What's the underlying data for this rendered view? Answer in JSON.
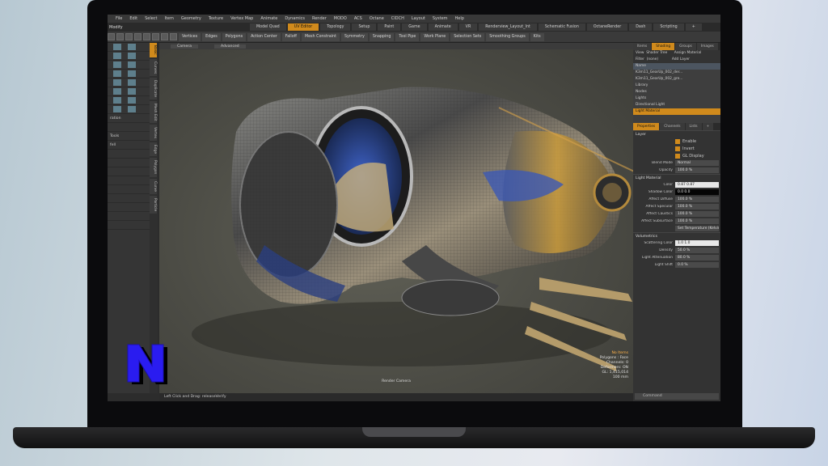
{
  "menubar": [
    "File",
    "Edit",
    "Select",
    "Item",
    "Geometry",
    "Texture",
    "Vertex Map",
    "Animate",
    "Dynamics",
    "Render",
    "MODO",
    "ACS",
    "Octane",
    "CIDCH",
    "Layout",
    "System",
    "Help"
  ],
  "workspace": "Modify",
  "layout_tabs": [
    {
      "label": "Model Quad",
      "active": false
    },
    {
      "label": "UV Editor",
      "active": true
    },
    {
      "label": "Topology",
      "active": false
    },
    {
      "label": "Setup",
      "active": false
    },
    {
      "label": "Paint",
      "active": false
    },
    {
      "label": "Game",
      "active": false
    },
    {
      "label": "Animate",
      "active": false
    },
    {
      "label": "VR",
      "active": false
    },
    {
      "label": "Renderview_Layout_Int",
      "active": false
    },
    {
      "label": "Schematic Fusion",
      "active": false
    },
    {
      "label": "OctaneRender",
      "active": false
    },
    {
      "label": "Dash",
      "active": false
    },
    {
      "label": "Scripting",
      "active": false
    },
    {
      "label": "+",
      "active": false
    }
  ],
  "toolbar": [
    "Vertices",
    "Edges",
    "Polygons",
    "Action Center",
    "Falloff",
    "Mesh Constraint",
    "Symmetry",
    "Snapping",
    "Tool Pipe",
    "Work Plane",
    "Selection Sets",
    "Smoothing Groups",
    "Kits"
  ],
  "left_panel_rows": [
    "",
    "",
    "",
    "",
    "",
    "",
    "",
    "",
    "ration",
    "",
    "Tools",
    "fell",
    "",
    "",
    "",
    "",
    "",
    "",
    "",
    "",
    ""
  ],
  "vertical_tabs": [
    {
      "label": "Basic",
      "active": true
    },
    {
      "label": "Curves",
      "active": false
    },
    {
      "label": "Duplicate",
      "active": false
    },
    {
      "label": "Mesh Edit",
      "active": false
    },
    {
      "label": "Vertex",
      "active": false
    },
    {
      "label": "Edge",
      "active": false
    },
    {
      "label": "Polygon",
      "active": false
    },
    {
      "label": "Curve",
      "active": false
    },
    {
      "label": "Particle",
      "active": false
    }
  ],
  "viewport": {
    "header_tabs": [
      "Camera",
      "Advanced"
    ],
    "stats": [
      "No Items",
      "Polygons : Face",
      "Channels: 0",
      "Deformers: ON",
      "GL: 1,415,014",
      "100 mm"
    ],
    "camera_label": "Render Camera"
  },
  "statusbar": "Left Click and Drag:  releaseVerify",
  "right_panel": {
    "tabs": [
      {
        "label": "Items",
        "active": false
      },
      {
        "label": "Shading",
        "active": true
      },
      {
        "label": "Groups",
        "active": false
      },
      {
        "label": "Images",
        "active": false
      }
    ],
    "view_label": "View",
    "view_value": "Shader Tree",
    "filter_label": "Filter",
    "filter_value": "(none)",
    "assign_button": "Assign Material",
    "add_layer_button": "Add Layer",
    "tree_header": "Name",
    "tree": [
      {
        "label": "K3m11_GearUp_002_der...",
        "sel": false
      },
      {
        "label": "K3m11_GearUp_002_gre...",
        "sel": false
      },
      {
        "label": "Library",
        "sel": false
      },
      {
        "label": "Nodes",
        "sel": false
      },
      {
        "label": "Lights",
        "sel": false
      },
      {
        "label": "Directional Light",
        "sel": false
      },
      {
        "label": "Light Material",
        "sel": true
      }
    ],
    "prop_tabs": [
      {
        "label": "Properties",
        "active": true
      },
      {
        "label": "Channels",
        "active": false
      },
      {
        "label": "Lists",
        "active": false
      },
      {
        "label": "+",
        "active": false
      }
    ],
    "layer_section": "Layer",
    "checkboxes": [
      "Enable",
      "Invert",
      "GL Display"
    ],
    "props_layer": [
      {
        "label": "Blend Mode",
        "value": "Normal",
        "style": ""
      },
      {
        "label": "Opacity",
        "value": "100.0 %",
        "style": ""
      }
    ],
    "light_material_section": "Light Material",
    "props_light": [
      {
        "label": "Color",
        "value": "0.87     0.87",
        "style": "white"
      },
      {
        "label": "Shadow Color",
        "value": "0.0      0.0",
        "style": "black"
      },
      {
        "label": "Affect Diffuse",
        "value": "100.0 %",
        "style": ""
      },
      {
        "label": "Affect Specular",
        "value": "100.0 %",
        "style": ""
      },
      {
        "label": "Affect Caustics",
        "value": "100.0 %",
        "style": ""
      },
      {
        "label": "Affect Subsurface",
        "value": "100.0 %",
        "style": ""
      }
    ],
    "set_temperature": "Set Temperature (Kelvin)",
    "volumetrics_section": "Volumetrics",
    "props_vol": [
      {
        "label": "Scattering Color",
        "value": "1.0      1.0",
        "style": "white"
      },
      {
        "label": "Density",
        "value": "50.0 %",
        "style": ""
      },
      {
        "label": "Light Attenuation",
        "value": "80.0 %",
        "style": ""
      },
      {
        "label": "Light Shift",
        "value": "0.0 %",
        "style": ""
      }
    ],
    "command_placeholder": "Command"
  },
  "logo_letter": "N",
  "colors": {
    "accent": "#d08a1c",
    "logo_fill": "#2a1cf0",
    "logo_shadow": "#000000"
  }
}
